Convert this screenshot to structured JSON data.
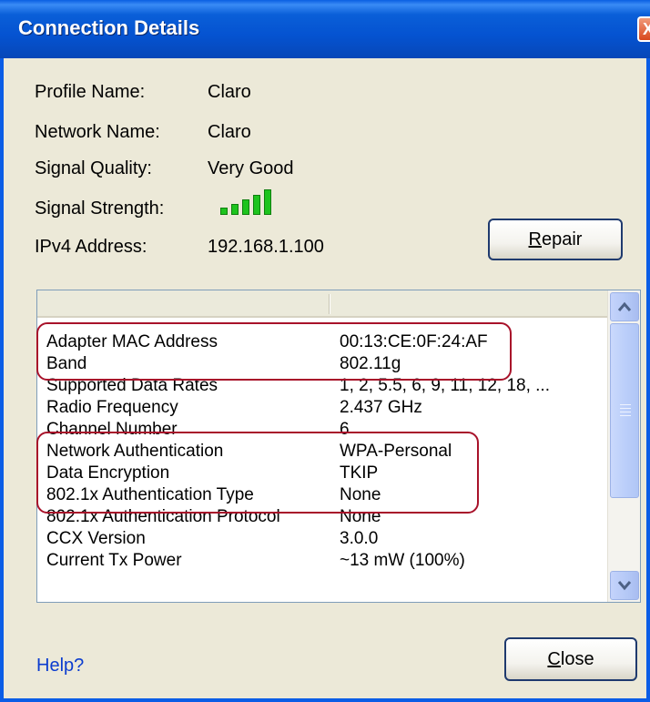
{
  "window": {
    "title": "Connection Details",
    "close_glyph": "X"
  },
  "info": {
    "profile_name_label": "Profile Name:",
    "profile_name": "Claro",
    "network_name_label": "Network Name:",
    "network_name": "Claro",
    "signal_quality_label": "Signal Quality:",
    "signal_quality": "Very Good",
    "signal_strength_label": "Signal Strength:",
    "signal_strength_bars": 5,
    "signal_strength_max": 5,
    "ipv4_label": "IPv4 Address:",
    "ipv4": "192.168.1.100"
  },
  "buttons": {
    "repair_mnemonic": "R",
    "repair_rest": "epair",
    "close_mnemonic": "C",
    "close_rest": "lose"
  },
  "details": {
    "rows": [
      {
        "key": "Adapter MAC Address",
        "value": "00:13:CE:0F:24:AF"
      },
      {
        "key": "Band",
        "value": "802.11g"
      },
      {
        "key": "Supported Data Rates",
        "value": "1, 2, 5.5, 6, 9, 11, 12, 18, ..."
      },
      {
        "key": "Radio Frequency",
        "value": "2.437 GHz"
      },
      {
        "key": "Channel Number",
        "value": "6"
      },
      {
        "key": "Network Authentication",
        "value": "WPA-Personal"
      },
      {
        "key": "Data Encryption",
        "value": "TKIP"
      },
      {
        "key": "802.1x Authentication Type",
        "value": "None"
      },
      {
        "key": "802.1x Authentication Protocol",
        "value": "None"
      },
      {
        "key": "CCX Version",
        "value": "3.0.0"
      },
      {
        "key": "Current Tx Power",
        "value": "~13 mW (100%)"
      }
    ]
  },
  "footer": {
    "help_link": "Help?"
  },
  "colors": {
    "titlebar": "#0553d1",
    "signal_bar": "#1ec41e",
    "highlight": "#a8122a",
    "link": "#0b3ccf"
  }
}
